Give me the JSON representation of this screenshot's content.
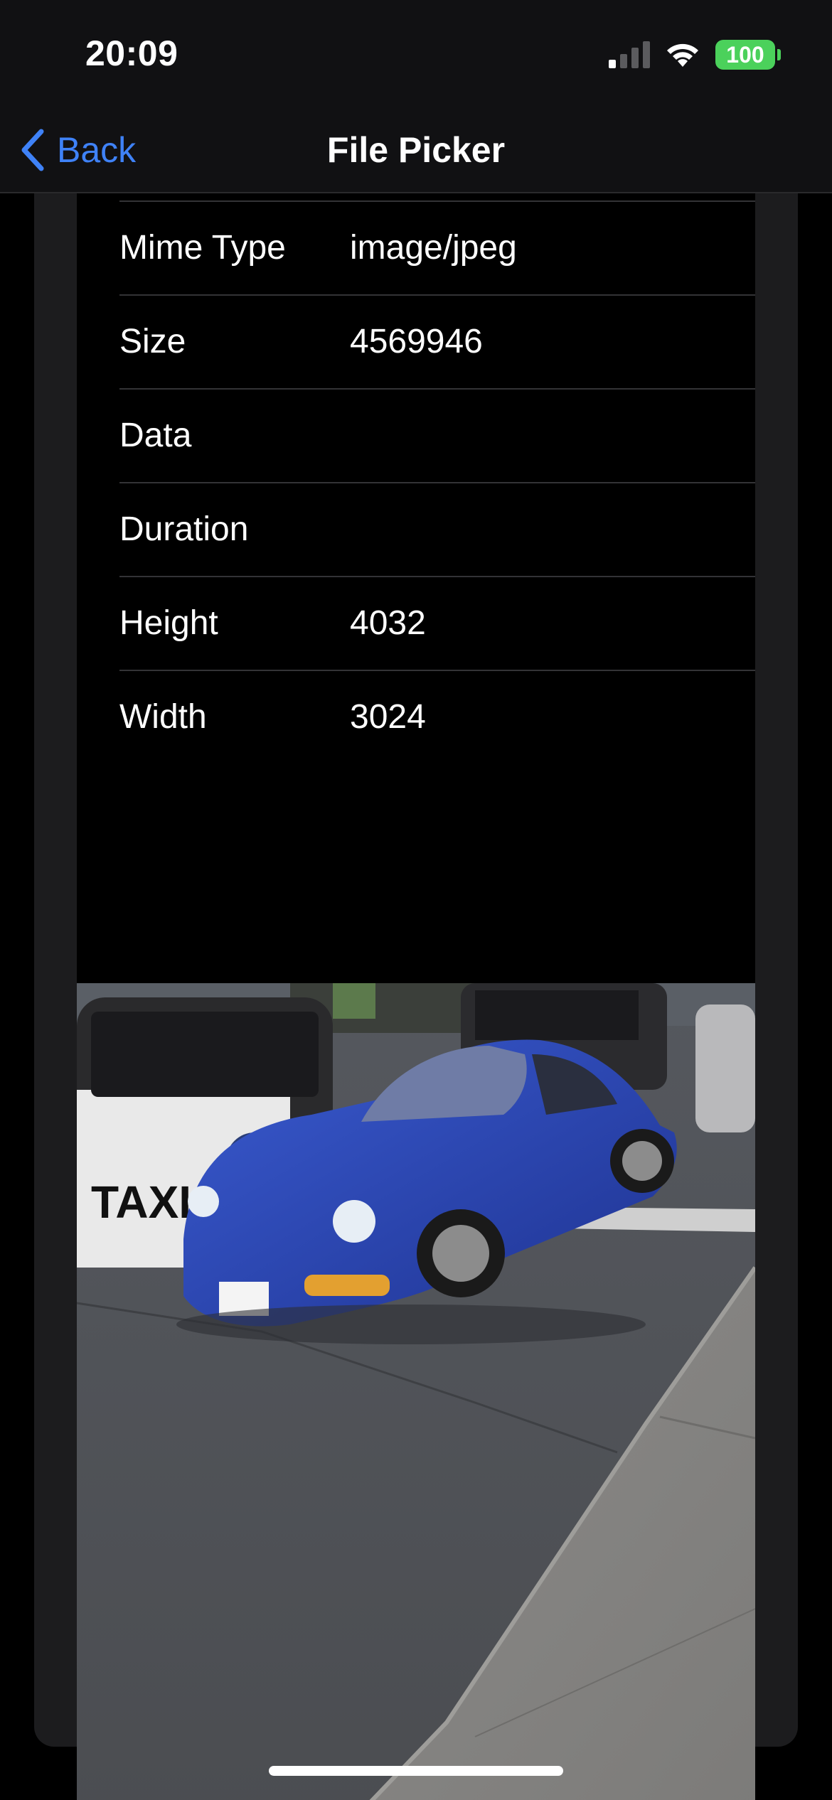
{
  "status_bar": {
    "time": "20:09",
    "battery": "100"
  },
  "nav": {
    "back_label": "Back",
    "title": "File Picker"
  },
  "file_info": {
    "rows": [
      {
        "label": "Mime Type",
        "value": "image/jpeg"
      },
      {
        "label": "Size",
        "value": "4569946"
      },
      {
        "label": "Data",
        "value": ""
      },
      {
        "label": "Duration",
        "value": ""
      },
      {
        "label": "Height",
        "value": "4032"
      },
      {
        "label": "Width",
        "value": "3024"
      }
    ]
  },
  "colors": {
    "accent": "#3f82f7",
    "battery": "#4bd15b",
    "card": "#1c1c1e",
    "car_blue": "#2a44a8"
  },
  "icons": {
    "back": "chevron-left-icon",
    "signal": "cellular-signal-icon",
    "wifi": "wifi-icon"
  }
}
